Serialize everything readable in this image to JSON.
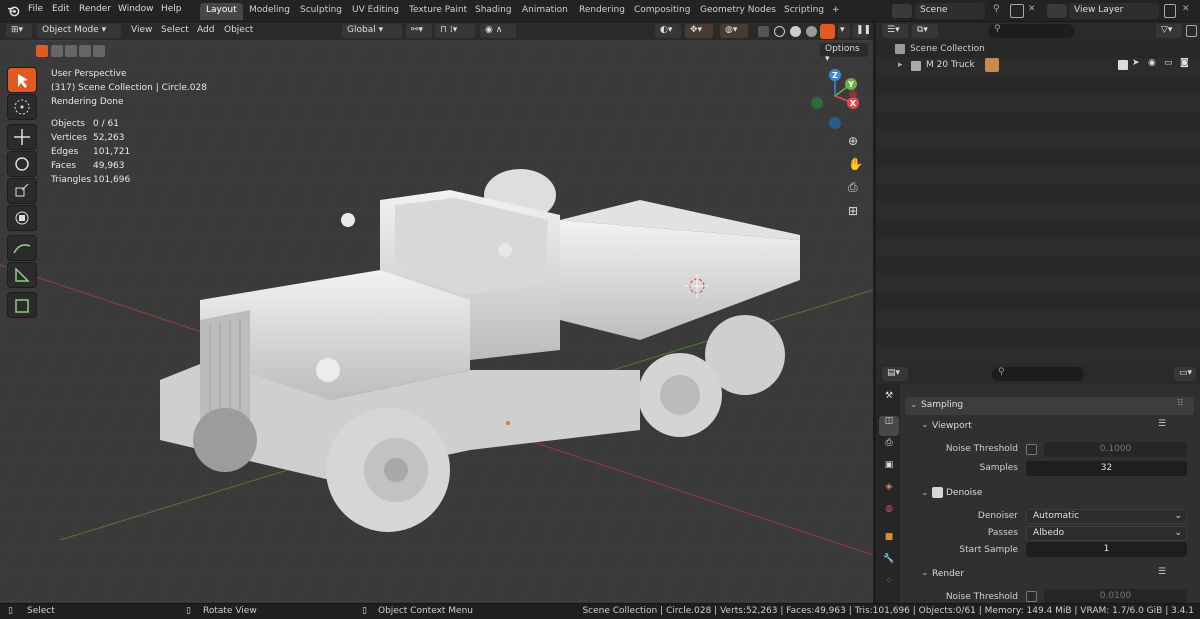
{
  "menus": [
    "File",
    "Edit",
    "Render",
    "Window",
    "Help"
  ],
  "workspaces": [
    "Layout",
    "Modeling",
    "Sculpting",
    "UV Editing",
    "Texture Paint",
    "Shading",
    "Animation",
    "Rendering",
    "Compositing",
    "Geometry Nodes",
    "Scripting"
  ],
  "active_workspace": "Layout",
  "add_tab": "+",
  "scene": "Scene",
  "view_layer": "View Layer",
  "header": {
    "mode": "Object Mode",
    "menu": [
      "View",
      "Select",
      "Add",
      "Object"
    ],
    "orientation": "Global",
    "options": "Options"
  },
  "overlay": {
    "line1": "User Perspective",
    "line2": "(317) Scene Collection | Circle.028",
    "line3": "Rendering Done",
    "stats": [
      {
        "label": "Objects",
        "value": "0 / 61"
      },
      {
        "label": "Vertices",
        "value": "52,263"
      },
      {
        "label": "Edges",
        "value": "101,721"
      },
      {
        "label": "Faces",
        "value": "49,963"
      },
      {
        "label": "Triangles",
        "value": "101,696"
      }
    ]
  },
  "gizmo": {
    "z": "Z",
    "x": "X",
    "y": "Y"
  },
  "outliner": {
    "root": "Scene Collection",
    "item": "M 20 Truck"
  },
  "properties": {
    "panel": "Sampling",
    "viewport": "Viewport",
    "noise_threshold_label": "Noise Threshold",
    "noise_threshold": "0.1000",
    "samples_label": "Samples",
    "samples": "32",
    "denoise": "Denoise",
    "denoiser_label": "Denoiser",
    "denoiser": "Automatic",
    "passes_label": "Passes",
    "passes": "Albedo",
    "start_sample_label": "Start Sample",
    "start_sample": "1",
    "render": "Render",
    "render_noise_label": "Noise Threshold",
    "render_noise": "0.0100"
  },
  "status": {
    "select": "Select",
    "rotate": "Rotate View",
    "context": "Object Context Menu",
    "info": "Scene Collection | Circle.028 | Verts:52,263 | Faces:49,963 | Tris:101,696 | Objects:0/61 | Memory: 149.4 MiB | VRAM: 1.7/6.0 GiB | 3.4.1"
  },
  "colors": {
    "accent": "#e05a22",
    "x_axis": "#e44c4c",
    "y_axis": "#6cb04a",
    "z_axis": "#3b86d8"
  }
}
